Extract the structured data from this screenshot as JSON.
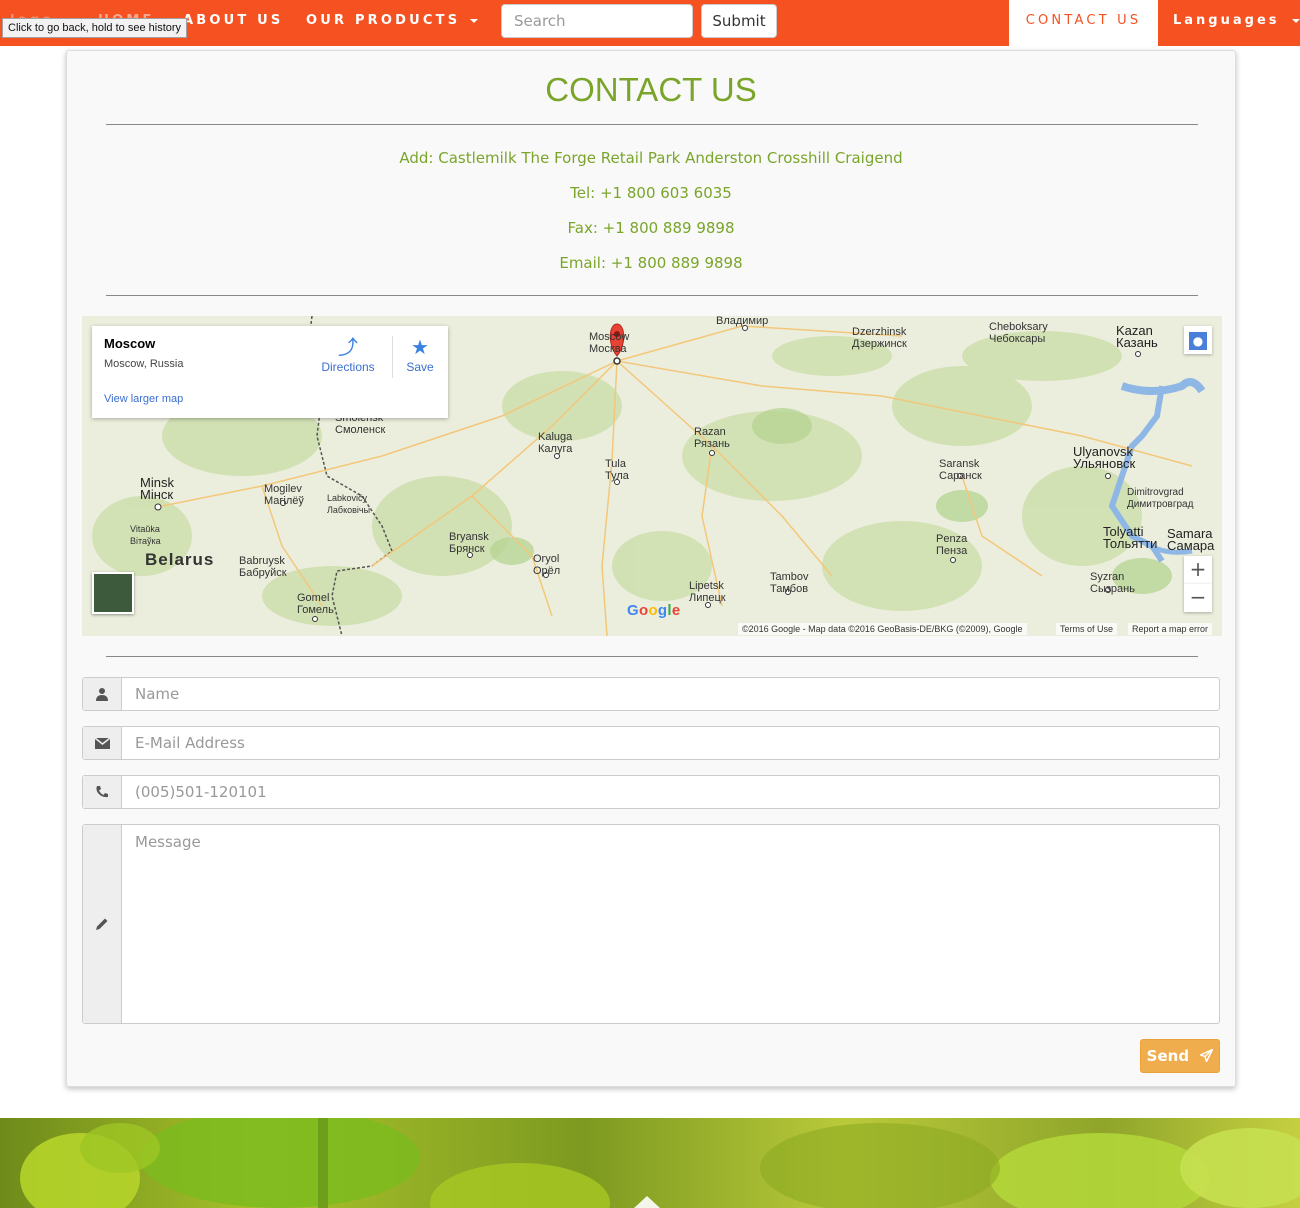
{
  "nav": {
    "logo": "logo",
    "home": "HOME",
    "about": "ABOUT US",
    "products": "OUR PRODUCTS",
    "search_placeholder": "Search",
    "submit": "Submit",
    "contact": "CONTACT US",
    "languages": "Languages"
  },
  "tooltip": "Click to go back, hold to see history",
  "contact": {
    "title": "CONTACT US",
    "address": "Add: Castlemilk The Forge Retail Park Anderston Crosshill Craigend",
    "tel": "Tel: +1 800 603 6035",
    "fax": "Fax: +1 800 889 9898",
    "email": "Email: +1 800 889 9898"
  },
  "map": {
    "card_title": "Moscow",
    "card_subtitle": "Moscow, Russia",
    "directions": "Directions",
    "save": "Save",
    "view_larger": "View larger map",
    "zoom_in": "+",
    "zoom_out": "−",
    "google": "Google",
    "attribution": "©2016 Google - Map data ©2016 GeoBasis-DE/BKG (©2009), Google",
    "terms": "Terms of Use",
    "report": "Report a map error",
    "places": {
      "moscow_en": "Moscow",
      "moscow_ru": "Москва",
      "vladimir": "Владимир",
      "dzerzhinsk_en": "Dzerzhinsk",
      "dzerzhinsk_ru": "Дзержинск",
      "cheboksary_en": "Cheboksary",
      "cheboksary_ru": "Чебоксары",
      "kazan_en": "Kazan",
      "kazan_ru": "Казань",
      "smolensk_en": "Smolensk",
      "smolensk_ru": "Смоленск",
      "kaluga_en": "Kaluga",
      "kaluga_ru": "Калуга",
      "razan_en": "Razan",
      "razan_ru": "Рязань",
      "ulyanovsk_en": "Ulyanovsk",
      "ulyanovsk_ru": "Ульяновск",
      "minsk_en": "Minsk",
      "minsk_ru": "Мінск",
      "mogilev_en": "Mogilev",
      "mogilev_ru": "Магілёў",
      "labkovichy_en": "Labkovičy",
      "labkovichy_ru": "Лабковічы",
      "tula_en": "Tula",
      "tula_ru": "Тула",
      "saransk_en": "Saransk",
      "saransk_ru": "Саранск",
      "dimitrovgrad_en": "Dimitrovgrad",
      "dimitrovgrad_ru": "Димитровград",
      "vitauka_en": "Vitaŭka",
      "vitauka_ru": "Вітаўка",
      "bryansk_en": "Bryansk",
      "bryansk_ru": "Брянск",
      "tolyatti_en": "Tolyatti",
      "tolyatti_ru": "Тольятти",
      "samara_en": "Samara",
      "samara_ru": "Самара",
      "penza_en": "Penza",
      "penza_ru": "Пенза",
      "belarus": "Belarus",
      "babruysk_en": "Babruysk",
      "babruysk_ru": "Бабруйск",
      "oryol_en": "Oryol",
      "oryol_ru": "Орёл",
      "syzran_en": "Syzran",
      "syzran_ru": "Сызрань",
      "tambov_en": "Tambov",
      "tambov_ru": "Тамбов",
      "lipetsk_en": "Lipetsk",
      "lipetsk_ru": "Липецк",
      "gomel_en": "Gomel",
      "gomel_ru": "Гомель"
    }
  },
  "form": {
    "name_placeholder": "Name",
    "email_placeholder": "E-Mail Address",
    "phone_placeholder": "(005)501-120101",
    "message_placeholder": "Message",
    "send": "Send"
  },
  "colors": {
    "nav_bg": "#f55121",
    "accent_green": "#7aa52a",
    "send_button": "#f0ad4e"
  }
}
